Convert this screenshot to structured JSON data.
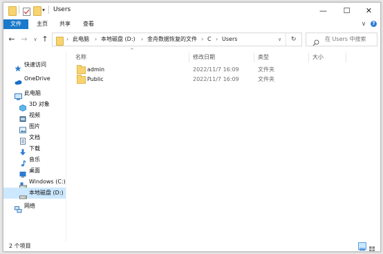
{
  "window": {
    "title": "Users",
    "minimize": "—",
    "maximize": "☐",
    "close": "✕"
  },
  "ribbon": {
    "tabs": [
      "文件",
      "主页",
      "共享",
      "查看"
    ],
    "expand_icon": "∨",
    "help_icon": "?"
  },
  "navigation": {
    "back": "←",
    "forward": "→",
    "recent": "∨",
    "up": "↑",
    "refresh": "↻",
    "history_dropdown": "∨"
  },
  "address": {
    "segments": [
      "此电脑",
      "本地磁盘 (D:)",
      "金舟数据恢复的文件",
      "C",
      "Users"
    ]
  },
  "search": {
    "placeholder": "在 Users 中搜索"
  },
  "sidebar": {
    "items": [
      {
        "label": "快速访问",
        "icon": "star-icon"
      },
      {
        "label": "OneDrive",
        "icon": "cloud-icon"
      },
      {
        "label": "此电脑",
        "icon": "computer-icon"
      },
      {
        "label": "3D 对象",
        "icon": "cube-icon"
      },
      {
        "label": "视频",
        "icon": "video-icon"
      },
      {
        "label": "图片",
        "icon": "image-icon"
      },
      {
        "label": "文档",
        "icon": "document-icon"
      },
      {
        "label": "下载",
        "icon": "download-icon"
      },
      {
        "label": "音乐",
        "icon": "music-icon"
      },
      {
        "label": "桌面",
        "icon": "desktop-icon"
      },
      {
        "label": "Windows (C:)",
        "icon": "drive-icon"
      },
      {
        "label": "本地磁盘 (D:)",
        "icon": "drive-icon",
        "selected": true
      },
      {
        "label": "网络",
        "icon": "network-icon"
      }
    ]
  },
  "table": {
    "columns": [
      "名称",
      "修改日期",
      "类型",
      "大小"
    ],
    "rows": [
      {
        "name": "admin",
        "modified": "2022/11/7 16:09",
        "type": "文件夹",
        "size": ""
      },
      {
        "name": "Public",
        "modified": "2022/11/7 16:09",
        "type": "文件夹",
        "size": ""
      }
    ]
  },
  "status": {
    "item_count": "2 个项目"
  },
  "colors": {
    "accent": "#1979ca",
    "selection": "#cce8ff",
    "folder": "#f7d46f"
  }
}
